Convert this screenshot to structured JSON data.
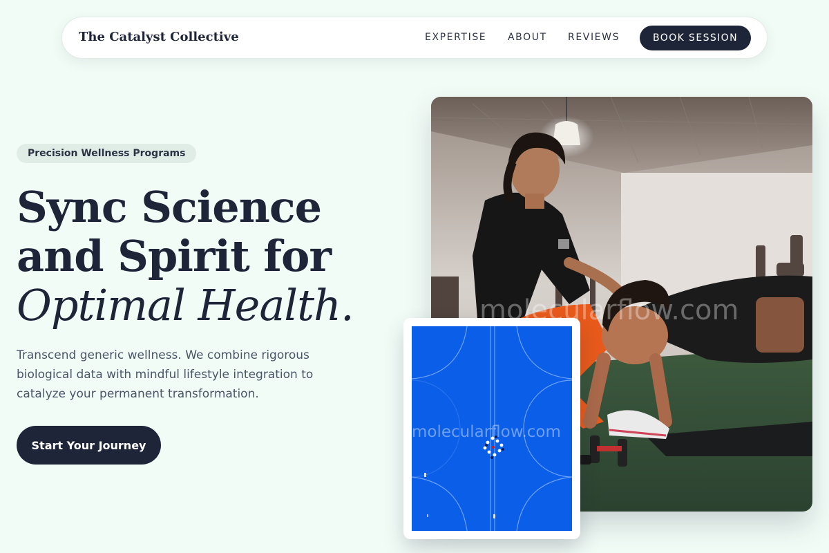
{
  "nav": {
    "brand": "The Catalyst Collective",
    "links": [
      "EXPERTISE",
      "ABOUT",
      "REVIEWS"
    ],
    "cta": "BOOK SESSION"
  },
  "hero": {
    "eyebrow": "Precision Wellness Programs",
    "headline": {
      "line1": "Sync Science",
      "line2": "and Spirit for",
      "line3": "Optimal Health."
    },
    "lede": "Transcend generic wellness. We combine rigorous biological data with mindful lifestyle integration to catalyze your permanent transformation.",
    "cta": "Start Your Journey"
  },
  "images": {
    "main_watermark": "molecularflow.com",
    "inset_watermark": "molecularflow.com"
  },
  "colors": {
    "background": "#f2fcf7",
    "primary": "#1e2538",
    "badge": "#e0ece6",
    "court_blue": "#0a5ee8"
  }
}
